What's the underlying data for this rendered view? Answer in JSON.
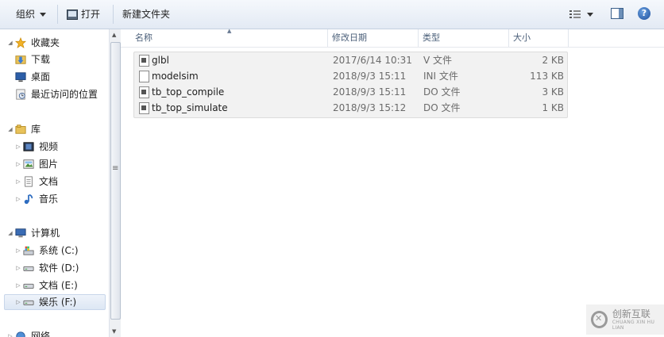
{
  "toolbar": {
    "organize_label": "组织",
    "open_label": "打开",
    "new_folder_label": "新建文件夹"
  },
  "nav": {
    "favorites": "收藏夹",
    "downloads": "下载",
    "desktop": "桌面",
    "recent": "最近访问的位置",
    "libraries": "库",
    "videos": "视频",
    "pictures": "图片",
    "documents": "文档",
    "music": "音乐",
    "computer": "计算机",
    "drive_c": "系统 (C:)",
    "drive_d": "软件 (D:)",
    "drive_e": "文档 (E:)",
    "drive_f": "娱乐 (F:)",
    "network": "网络"
  },
  "columns": {
    "name": "名称",
    "date": "修改日期",
    "type": "类型",
    "size": "大小"
  },
  "files": [
    {
      "name": "glbl",
      "date": "2017/6/14 10:31",
      "type": "V 文件",
      "size": "2 KB"
    },
    {
      "name": "modelsim",
      "date": "2018/9/3 15:11",
      "type": "INI 文件",
      "size": "113 KB"
    },
    {
      "name": "tb_top_compile",
      "date": "2018/9/3 15:11",
      "type": "DO 文件",
      "size": "3 KB"
    },
    {
      "name": "tb_top_simulate",
      "date": "2018/9/3 15:12",
      "type": "DO 文件",
      "size": "1 KB"
    }
  ],
  "watermark": {
    "text": "创新互联",
    "sub": "CHUANG XIN HU LIAN"
  },
  "colors": {
    "toolbar_bg": "#e3eaf4",
    "selection": "#dde7f4",
    "header_text": "#4c607a"
  }
}
